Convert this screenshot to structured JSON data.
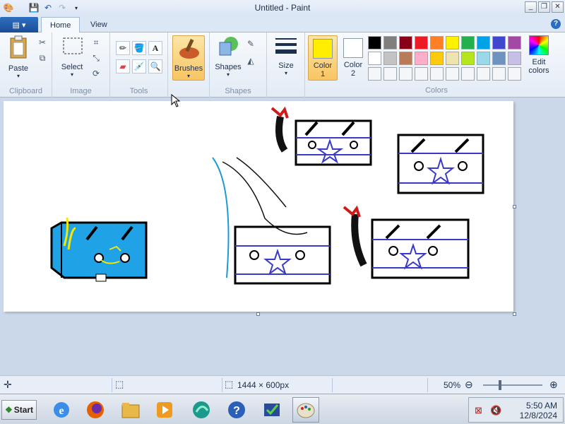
{
  "window": {
    "title": "Untitled - Paint"
  },
  "tabs": {
    "file_label": "▤ ▾",
    "home": "Home",
    "view": "View"
  },
  "ribbon": {
    "clipboard": {
      "paste": "Paste",
      "group": "Clipboard"
    },
    "image": {
      "select": "Select",
      "group": "Image"
    },
    "tools": {
      "group": "Tools"
    },
    "brushes": "Brushes",
    "shapes": {
      "label": "Shapes",
      "group": "Shapes"
    },
    "size": "Size",
    "color1": {
      "line1": "Color",
      "line2": "1",
      "value": "#ffee00"
    },
    "color2": {
      "line1": "Color",
      "line2": "2",
      "value": "#ffffff"
    },
    "colors_group": "Colors",
    "edit_colors": {
      "line1": "Edit",
      "line2": "colors"
    },
    "palette": [
      "#000000",
      "#7f7f7f",
      "#880015",
      "#ed1c24",
      "#ff7f27",
      "#fff200",
      "#22b14c",
      "#00a2e8",
      "#3f48cc",
      "#a349a4",
      "#ffffff",
      "#c3c3c3",
      "#b97a57",
      "#ffaec9",
      "#ffc90e",
      "#efe4b0",
      "#b5e61d",
      "#99d9ea",
      "#7092be",
      "#c8bfe7"
    ]
  },
  "status": {
    "dimensions": "1444 × 600px",
    "zoom": "50%"
  },
  "taskbar": {
    "start": "Start",
    "time": "5:50 AM",
    "date": "12/8/2024"
  }
}
